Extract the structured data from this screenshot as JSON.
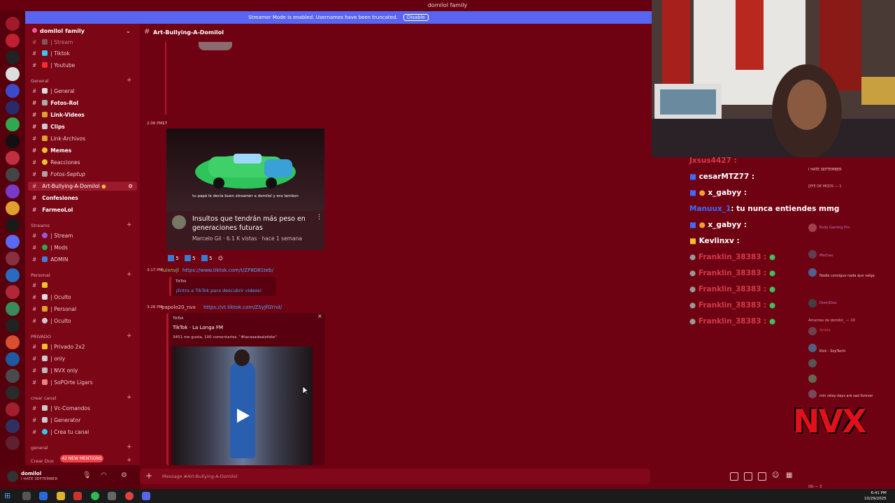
{
  "window": {
    "title": "domilol family"
  },
  "banner": {
    "text": "Streamer Mode is enabled. Usernames have been truncated.",
    "button": "Disable"
  },
  "server": {
    "name": "domilol family"
  },
  "channels": {
    "top": [
      {
        "name": "| Stream"
      },
      {
        "name": "| Tiktok"
      },
      {
        "name": "| Youtube"
      }
    ],
    "general_label": "General",
    "general": [
      {
        "name": "| General"
      },
      {
        "name": "Fotos-Rol"
      },
      {
        "name": "Link-Videos"
      },
      {
        "name": "Clips"
      },
      {
        "name": "Link-Archivos"
      },
      {
        "name": "Memes"
      },
      {
        "name": "Reacciones"
      },
      {
        "name": "Fotos-Septup"
      },
      {
        "name": "Art-Bullying-A-Domilol"
      },
      {
        "name": "Confesiones"
      },
      {
        "name": "FarmeoLol"
      }
    ],
    "streams_label": "Streams",
    "streams": [
      {
        "name": "| Stream"
      },
      {
        "name": "| Mods"
      },
      {
        "name": "ADMIN"
      }
    ],
    "personal_label": "Personal",
    "personal": [
      {
        "name": ""
      },
      {
        "name": "| Oculto"
      },
      {
        "name": "| Personal"
      },
      {
        "name": "| Oculto"
      }
    ],
    "privado_label": "PRIVADO",
    "privado": [
      {
        "name": "| Privado 2x2"
      },
      {
        "name": "| only"
      },
      {
        "name": "| NVX only"
      },
      {
        "name": "| SoPOrte Ligars"
      }
    ],
    "crear_label": "crear canal",
    "crear": [
      {
        "name": "| Vc-Comandos"
      },
      {
        "name": "| Generator"
      },
      {
        "name": "| Crea tu canal"
      }
    ],
    "general2_label": "general",
    "crear_duo_label": "Crear Duo"
  },
  "mentions": "42 NEW MENTIONS",
  "user": {
    "name": "domilol",
    "status": "I HATE SEPTEMBER"
  },
  "channel_header": "Art-Bullying-A-Domilol",
  "messages": {
    "m1_time": "2:06 PM",
    "m1_extra": "17",
    "video1": {
      "caption": "tu papá le decía buen streamer a domilol y era lambon",
      "title": "Insultos que tendrán más peso en generaciones futuras",
      "meta": "Marcelo Gil · 6.1 K vistas · hace 1 semana"
    },
    "reactions": [
      {
        "label": "5",
        "color": "#3a7ad6"
      },
      {
        "label": "5",
        "color": "#3a7ad6"
      },
      {
        "label": "5",
        "color": "#3a7ad6"
      }
    ],
    "m2_time": "3:17 PM",
    "m2_user": "luixnvjl",
    "m2_link": "https://www.tiktok.com/t/ZP8D81teb/",
    "tiktok1": {
      "site": "TikTok",
      "text": "¡Entra a TikTok para descubrir videos!"
    },
    "m3_time": "3:26 PM",
    "m3_user": "papolo20_nvx",
    "m3_link": "https://vt.tiktok.com/ZSyJfGYnd/",
    "tiktok2": {
      "site": "TikTok",
      "title": "TikTok · La Longa FM",
      "meta": "3451 me gusta, 100 comentarios. \"#lacasadealofoke\""
    }
  },
  "input_placeholder": "Message #Art-Bullying-A-Domilol",
  "chat_overlay": [
    {
      "user": "Jxsus4427 :",
      "msg": "",
      "color": "#d23a4a"
    },
    {
      "user": "cesarMTZ77 :",
      "msg": "",
      "color": "#ffffff"
    },
    {
      "user": "x_gabyy :",
      "msg": "",
      "color": "#ffffff"
    },
    {
      "user": "Manuux_1",
      "msg": ": tu nunca entiendes mmg",
      "color": "#3b6bff"
    },
    {
      "user": "x_gabyy :",
      "msg": "",
      "color": "#ffffff"
    },
    {
      "user": "Kevlinxv :",
      "msg": "",
      "color": "#ffffff"
    },
    {
      "user": "Franklin_38383 :",
      "msg": "",
      "color": "#d23a4a"
    },
    {
      "user": "Franklin_38383 :",
      "msg": "",
      "color": "#d23a4a"
    },
    {
      "user": "Franklin_38383 :",
      "msg": "",
      "color": "#d23a4a"
    },
    {
      "user": "Franklin_38383 :",
      "msg": "",
      "color": "#d23a4a"
    },
    {
      "user": "Franklin_38383 :",
      "msg": "",
      "color": "#d23a4a"
    }
  ],
  "members": {
    "status": "I HATE SEPTEMBER",
    "jefe_label": "JEFE DE MODS — 1",
    "amantes_label": "Amantes de domilol_ — 10",
    "m1": "Endy Gaming Pro",
    "m2": "Mechax",
    "m3": "Nadie consigue nada que valga",
    "m4": "Dom/Dios",
    "m5": "Aniela",
    "m6": "Kick - SoyTechi",
    "m7": "min relay days are sad forever",
    "og": "OG — 3"
  },
  "overlay_logo": "NVX",
  "clock": {
    "time": "6:41 PM",
    "date": "10/29/2025"
  }
}
